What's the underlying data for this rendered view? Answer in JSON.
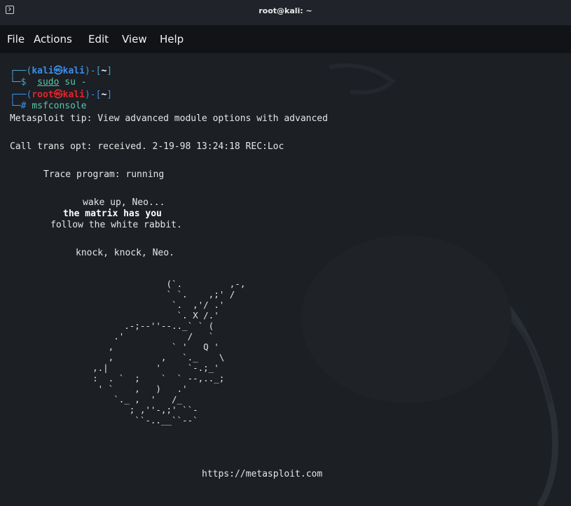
{
  "window": {
    "title": "root@kali: ~"
  },
  "menu": {
    "items": [
      "File",
      "Actions",
      "Edit",
      "View",
      "Help"
    ]
  },
  "colors": {
    "user_prompt": "#3b8eea",
    "root_prompt": "#e5242b",
    "command": "#58c7a8",
    "text": "#e6e6e6",
    "background": "#1c1f24"
  },
  "terminal": {
    "prompt1": {
      "open": "┌──(",
      "user": "kali",
      "at": "㉿",
      "host": "kali",
      "close": ")-[",
      "dir": "~",
      "end": "]",
      "marker": "└─$",
      "command": "sudo",
      "args": " su -"
    },
    "prompt2": {
      "open": "┌──(",
      "user": "root",
      "at": "㉿",
      "host": "kali",
      "close": ")-[",
      "dir": "~",
      "end": "]",
      "marker": "└─#",
      "command": "msfconsole"
    },
    "tip": "Metasploit tip: View advanced module options with advanced",
    "call_trans": "Call trans opt: received. 2-19-98 13:24:18 REC:Loc",
    "trace": "Trace program: running",
    "wake": "wake up, Neo...",
    "matrix": "the matrix has you",
    "follow": "follow the white rabbit.",
    "knock": "knock, knock, Neo.",
    "rabbit_art": "                  (`.         ,-,\n                  ` `.    ,;' /\n                   `.  ,'/ .'\n                    `. X /.'\n          .-;--''--.._` ` (\n        .'            /   `\n       ,           ` '   Q '\n       ,         ,   `._    \\\n    ,.|         '     `-.;_'\n    :  . `  ;    `  ` --,.._;\n     ' `    ,   )   .'\n        `._ ,  '   /_\n           ; ,''-,;' ``-\n            ``-..__``--`",
    "url": "https://metasploit.com"
  }
}
